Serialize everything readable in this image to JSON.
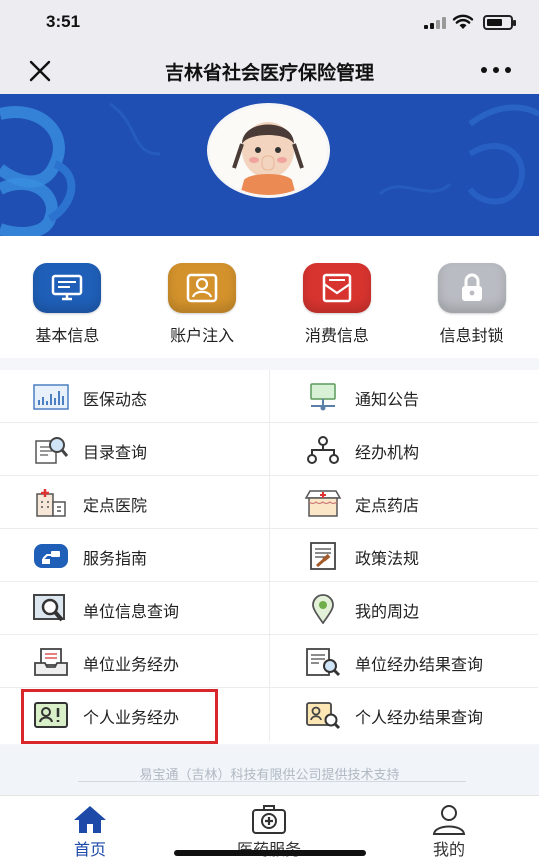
{
  "status_bar": {
    "time": "3:51"
  },
  "nav": {
    "title": "吉林省社会医疗保险管理"
  },
  "quick_actions": [
    {
      "label": "基本信息",
      "icon": "monitor-icon",
      "color": "#1f5fb8"
    },
    {
      "label": "账户注入",
      "icon": "person-card-icon",
      "color": "#d3922c"
    },
    {
      "label": "消费信息",
      "icon": "envelope-card-icon",
      "color": "#d8342f"
    },
    {
      "label": "信息封锁",
      "icon": "lock-icon",
      "color": "#b9bcc2"
    }
  ],
  "menu": [
    {
      "label": "医保动态",
      "icon": "bar-chart-icon"
    },
    {
      "label": "通知公告",
      "icon": "notice-board-icon"
    },
    {
      "label": "目录查询",
      "icon": "document-search-icon"
    },
    {
      "label": "经办机构",
      "icon": "org-tree-icon"
    },
    {
      "label": "定点医院",
      "icon": "hospital-icon"
    },
    {
      "label": "定点药店",
      "icon": "pharmacy-icon"
    },
    {
      "label": "服务指南",
      "icon": "service-guide-icon"
    },
    {
      "label": "政策法规",
      "icon": "policy-document-icon"
    },
    {
      "label": "单位信息查询",
      "icon": "monitor-search-icon"
    },
    {
      "label": "我的周边",
      "icon": "location-pin-icon"
    },
    {
      "label": "单位业务经办",
      "icon": "inbox-tray-icon"
    },
    {
      "label": "单位经办结果查询",
      "icon": "document-magnifier-icon"
    },
    {
      "label": "个人业务经办",
      "icon": "person-badge-icon"
    },
    {
      "label": "个人经办结果查询",
      "icon": "person-search-icon"
    }
  ],
  "footer": {
    "text": "易宝通（吉林）科技有限供公司提供技术支持"
  },
  "tabs": [
    {
      "label": "首页",
      "icon": "home-icon",
      "active": true
    },
    {
      "label": "医药服务",
      "icon": "medical-kit-icon",
      "active": false
    },
    {
      "label": "我的",
      "icon": "user-icon",
      "active": false
    }
  ],
  "colors": {
    "accent": "#1d4aa8",
    "banner": "#1f4fb3",
    "highlight": "#d9262b"
  }
}
